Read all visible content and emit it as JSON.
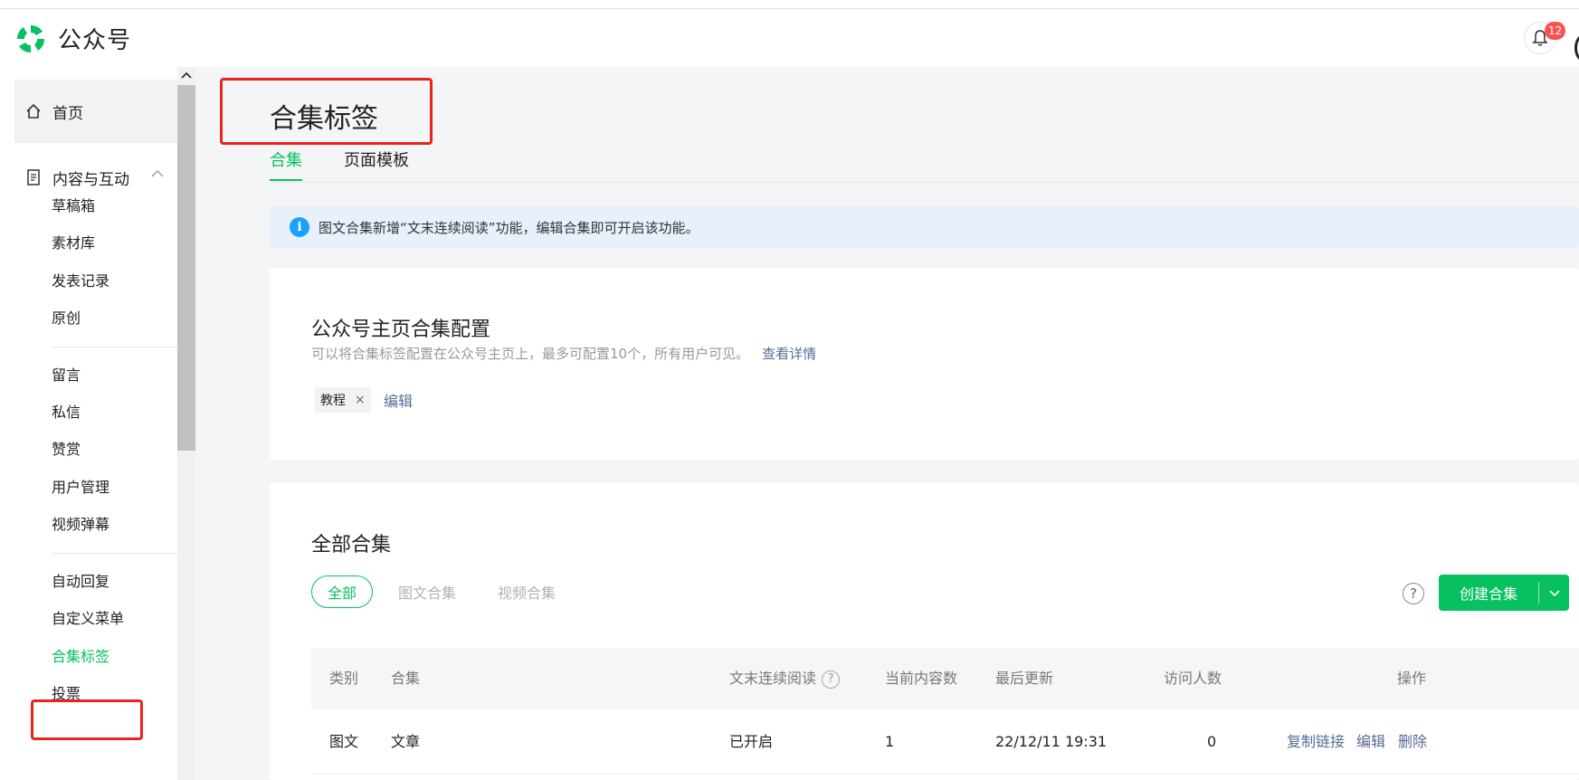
{
  "app": {
    "name": "公众号",
    "notification_count": "12"
  },
  "sidebar": {
    "home": "首页",
    "content_group": "内容与互动",
    "items_group1": [
      "草稿箱",
      "素材库",
      "发表记录",
      "原创"
    ],
    "items_group2": [
      "留言",
      "私信",
      "赞赏",
      "用户管理",
      "视频弹幕"
    ],
    "items_group3": [
      "自动回复",
      "自定义菜单",
      "合集标签",
      "投票"
    ]
  },
  "page": {
    "title": "合集标签",
    "tabs": [
      "合集",
      "页面模板"
    ]
  },
  "notice": {
    "icon": "info-icon",
    "text": "图文合集新增“文末连续阅读”功能，编辑合集即可开启该功能。"
  },
  "config_card": {
    "title": "公众号主页合集配置",
    "desc": "可以将合集标签配置在公众号主页上，最多可配置10个，所有用户可见。",
    "link": "查看详情",
    "tag": "教程",
    "tag_remove": "×",
    "edit": "编辑"
  },
  "all_card": {
    "title": "全部合集",
    "filters": [
      "全部",
      "图文合集",
      "视频合集"
    ],
    "help": "?",
    "create_button": "创建合集",
    "table": {
      "headers": [
        "类别",
        "合集",
        "文末连续阅读",
        "当前内容数",
        "最后更新",
        "访问人数",
        "操作"
      ],
      "rows": [
        {
          "type": "图文",
          "name": "文章",
          "continuous": "已开启",
          "count": "1",
          "updated": "22/12/11 19:31",
          "visitors": "0",
          "actions": [
            "复制链接",
            "编辑",
            "删除"
          ]
        }
      ]
    }
  },
  "colors": {
    "accent": "#07c160",
    "link": "#576b95",
    "highlight": "#e8241d"
  }
}
